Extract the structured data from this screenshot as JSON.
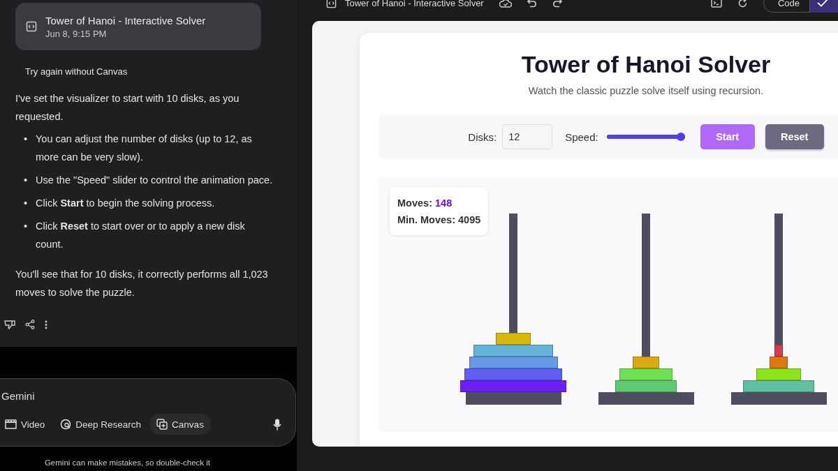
{
  "chat": {
    "artifact": {
      "title": "Tower of Hanoi - Interactive Solver",
      "date": "Jun 8, 9:15 PM"
    },
    "retry": "Try again without Canvas",
    "intro": "I've set the visualizer to start with 10 disks, as you requested.",
    "bullets": [
      {
        "marker": "•",
        "text": "You can adjust the number of disks (up to 12, as more can be very slow)."
      },
      {
        "marker": "•",
        "text": "Use the \"Speed\" slider to control the animation pace."
      },
      {
        "marker": "•",
        "text": "Click **Start** to begin the solving process."
      },
      {
        "marker": "•",
        "text": "Click **Reset** to start over or to apply a new disk count."
      }
    ],
    "outro": "You'll see that for 10 disks, it correctly performs all 1,023 moves to solve the puzzle."
  },
  "composer": {
    "placeholder": "Gemini",
    "tools": [
      {
        "kind": "video",
        "label": "Video",
        "selected": false
      },
      {
        "kind": "research",
        "label": "Deep Research",
        "selected": false
      },
      {
        "kind": "canvas",
        "label": "Canvas",
        "selected": true
      }
    ],
    "disclaimer": "Gemini can make mistakes, so double-check it"
  },
  "canvas": {
    "toolbar": {
      "title": "Tower of Hanoi - Interactive Solver",
      "code_button": "Code"
    },
    "app": {
      "title": "Tower of Hanoi Solver",
      "subtitle": "Watch the classic puzzle solve itself using recursion.",
      "disks_label": "Disks:",
      "disks_value": "12",
      "speed_label": "Speed:",
      "speed": {
        "level": 1
      },
      "start": "Start",
      "reset": "Reset",
      "moves_label": "Moves:",
      "moves": "148",
      "min_moves_label": "Min. Moves:",
      "min_moves": "4095",
      "disks_smallest_first": [
        {
          "color": "#d93a4a",
          "kind": "right"
        },
        {
          "color": "#e07810",
          "kind": "right"
        },
        {
          "color": "#dca912",
          "kind": "middle"
        },
        {
          "color": "#d6b70a",
          "kind": "left"
        },
        {
          "color": "#8ce31a",
          "kind": "right"
        },
        {
          "color": "#6ee052",
          "kind": "middle"
        },
        {
          "color": "#5ec873",
          "kind": "middle"
        },
        {
          "color": "#5ec0a0",
          "kind": "right"
        },
        {
          "color": "#66b3d9",
          "kind": "left"
        },
        {
          "color": "#6699e8",
          "kind": "left"
        },
        {
          "color": "#6060f0",
          "kind": "left"
        },
        {
          "color": "#6b21f5",
          "kind": "left"
        }
      ]
    }
  }
}
